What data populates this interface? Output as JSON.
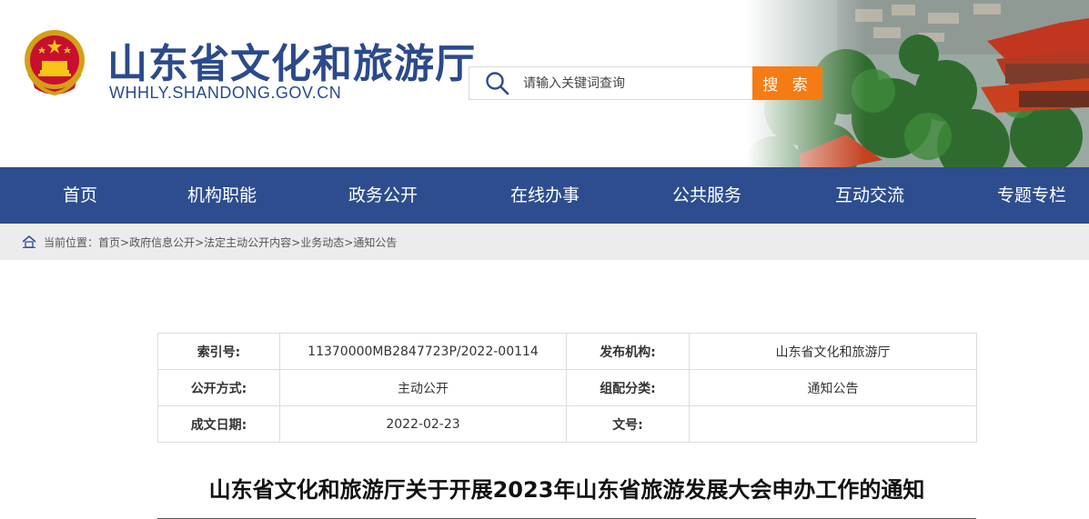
{
  "header": {
    "site_title": "山东省文化和旅游厅",
    "site_domain": "WHHLY.SHANDONG.GOV.CN",
    "emblem_icon": "national-emblem-icon"
  },
  "search": {
    "placeholder": "请输入关键词查询",
    "button_label": "搜 索",
    "button_color": "#f57c14"
  },
  "nav": {
    "background_color": "#2d4d8e",
    "items": [
      {
        "label": "首页"
      },
      {
        "label": "机构职能"
      },
      {
        "label": "政务公开"
      },
      {
        "label": "在线办事"
      },
      {
        "label": "公共服务"
      },
      {
        "label": "互动交流"
      },
      {
        "label": "专题专栏"
      }
    ]
  },
  "breadcrumb": {
    "prefix": "当前位置：",
    "items": [
      "首页",
      "政府信息公开",
      "法定主动公开内容",
      "业务动态",
      "通知公告"
    ],
    "separator": ">"
  },
  "meta": {
    "rows": [
      {
        "k1": "索引号:",
        "v1": "11370000MB2847723P/2022-00114",
        "k2": "发布机构:",
        "v2": "山东省文化和旅游厅"
      },
      {
        "k1": "公开方式:",
        "v1": "主动公开",
        "k2": "组配分类:",
        "v2": "通知公告"
      },
      {
        "k1": "成文日期:",
        "v1": "2022-02-23",
        "k2": "文号:",
        "v2": ""
      }
    ]
  },
  "article": {
    "title": "山东省文化和旅游厅关于开展2023年山东省旅游发展大会申办工作的通知"
  }
}
